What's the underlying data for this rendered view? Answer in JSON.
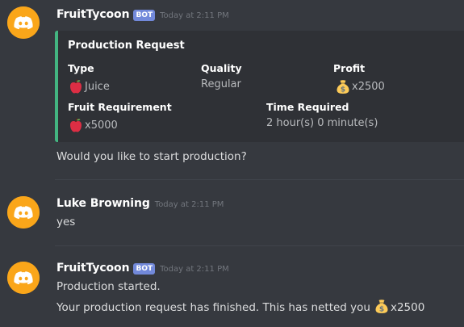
{
  "messages": [
    {
      "username": "FruitTycoon",
      "bot_tag": "BOT",
      "timestamp": "Today at 2:11 PM",
      "embed": {
        "accent_color": "#43b581",
        "title": "Production Request",
        "fields": {
          "type": {
            "name": "Type",
            "value": "Juice",
            "emoji": "apple-icon"
          },
          "quality": {
            "name": "Quality",
            "value": "Regular"
          },
          "profit": {
            "name": "Profit",
            "value": "x2500",
            "emoji": "money-bag-icon"
          },
          "fruit_requirement": {
            "name": "Fruit Requirement",
            "value": "x5000",
            "emoji": "apple-icon"
          },
          "time_required": {
            "name": "Time Required",
            "value": "2 hour(s) 0 minute(s)"
          }
        }
      },
      "text": "Would you like to start production?"
    },
    {
      "username": "Luke Browning",
      "timestamp": "Today at 2:11 PM",
      "text": "yes"
    },
    {
      "username": "FruitTycoon",
      "bot_tag": "BOT",
      "timestamp": "Today at 2:11 PM",
      "lines": [
        "Production started.",
        "Your production request has finished. This has netted you"
      ],
      "amount": "x2500",
      "amount_emoji": "money-bag-icon"
    }
  ],
  "colors": {
    "background": "#36393f",
    "embed_background": "#2f3136",
    "avatar": "#faa61a",
    "bot_tag": "#7289da",
    "username": "#ffffff",
    "timestamp": "#72767d"
  }
}
